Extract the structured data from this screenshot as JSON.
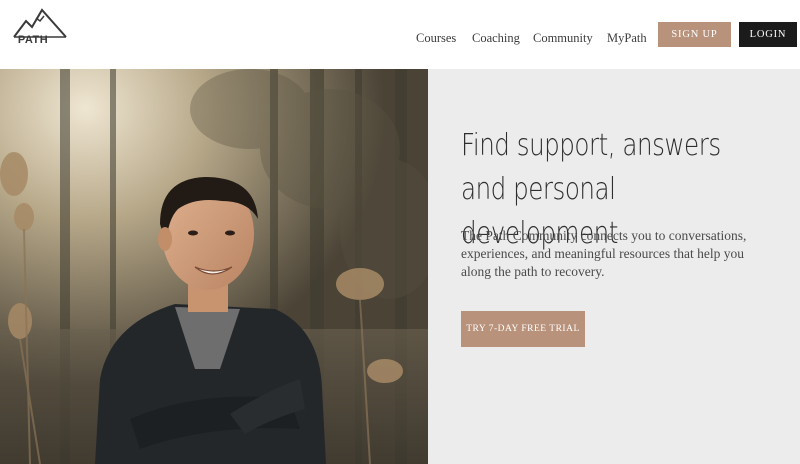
{
  "logo": {
    "text": "PATH",
    "icon": "mountain-icon"
  },
  "nav": {
    "items": [
      {
        "label": "Courses"
      },
      {
        "label": "Coaching"
      },
      {
        "label": "Community"
      },
      {
        "label": "MyPath"
      }
    ],
    "signup_label": "SIGN UP",
    "login_label": "LOGIN"
  },
  "hero": {
    "headline": "Find support, answers and personal development",
    "body": "The Path Community connects you to conversations, experiences, and meaningful resources that help you along the path to recovery.",
    "cta_label": "TRY 7-DAY FREE TRIAL",
    "image_description": ""
  },
  "colors": {
    "accent": "#b8927b",
    "dark": "#1b1b1b",
    "panel_bg": "#ececec",
    "text": "#2e2e2e"
  }
}
